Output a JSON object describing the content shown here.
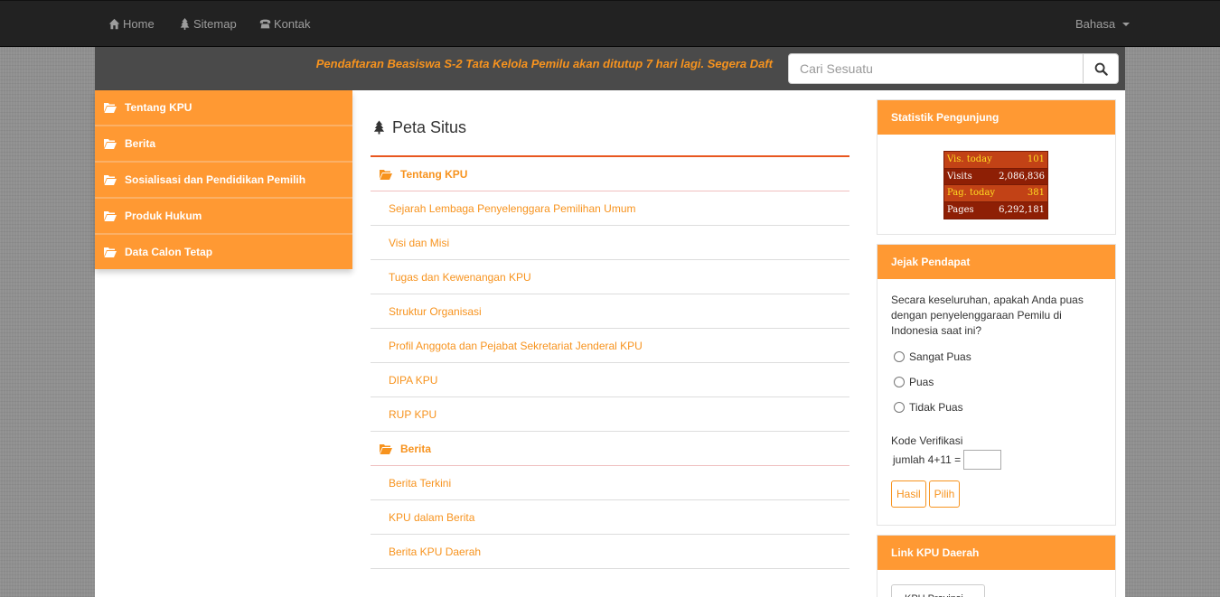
{
  "navbar": {
    "items": [
      {
        "label": "Home",
        "icon": "home-icon"
      },
      {
        "label": "Sitemap",
        "icon": "tree-icon"
      },
      {
        "label": "Kontak",
        "icon": "phone-icon"
      }
    ],
    "language_label": "Bahasa"
  },
  "announcement": {
    "text": "Pendaftaran Beasiswa S-2 Tata Kelola Pemilu akan ditutup 7 hari lagi. Segera Daft"
  },
  "search": {
    "placeholder": "Cari Sesuatu",
    "button_icon": "search-icon"
  },
  "sidebar": {
    "items": [
      {
        "label": "Tentang KPU"
      },
      {
        "label": "Berita"
      },
      {
        "label": "Sosialisasi dan Pendidikan Pemilih"
      },
      {
        "label": "Produk Hukum"
      },
      {
        "label": "Data Calon Tetap"
      }
    ]
  },
  "content": {
    "title": "Peta Situs",
    "sections": [
      {
        "category": "Tentang KPU",
        "links": [
          "Sejarah Lembaga Penyelenggara Pemilihan Umum",
          "Visi dan Misi",
          "Tugas dan Kewenangan KPU",
          "Struktur Organisasi",
          "Profil Anggota dan Pejabat Sekretariat Jenderal KPU",
          "DIPA KPU",
          "RUP KPU"
        ]
      },
      {
        "category": "Berita",
        "links": [
          "Berita Terkini",
          "KPU dalam Berita",
          "Berita KPU Daerah"
        ]
      }
    ]
  },
  "stats": {
    "title": "Statistik Pengunjung",
    "rows": [
      {
        "label": "Vis. today",
        "value": "101"
      },
      {
        "label": "Visits",
        "value": "2,086,836"
      },
      {
        "label": "Pag. today",
        "value": "381"
      },
      {
        "label": "Pages",
        "value": "6,292,181"
      }
    ]
  },
  "poll": {
    "title": "Jejak Pendapat",
    "question": "Secara keseluruhan, apakah Anda puas dengan penyelenggaraan Pemilu di Indonesia saat ini?",
    "options": [
      "Sangat Puas",
      "Puas",
      "Tidak Puas"
    ],
    "verification_label": "Kode Verifikasi",
    "verification_question": "jumlah 4+11 =",
    "result_button": "Hasil",
    "vote_button": "Pilih"
  },
  "regional": {
    "title": "Link KPU Daerah",
    "dropdown_label": "KPU Provinsi"
  },
  "colors": {
    "accent": "#ff9933",
    "link": "#f7931e",
    "navbar": "#222222",
    "announcement_bar": "#4a4a4a"
  }
}
